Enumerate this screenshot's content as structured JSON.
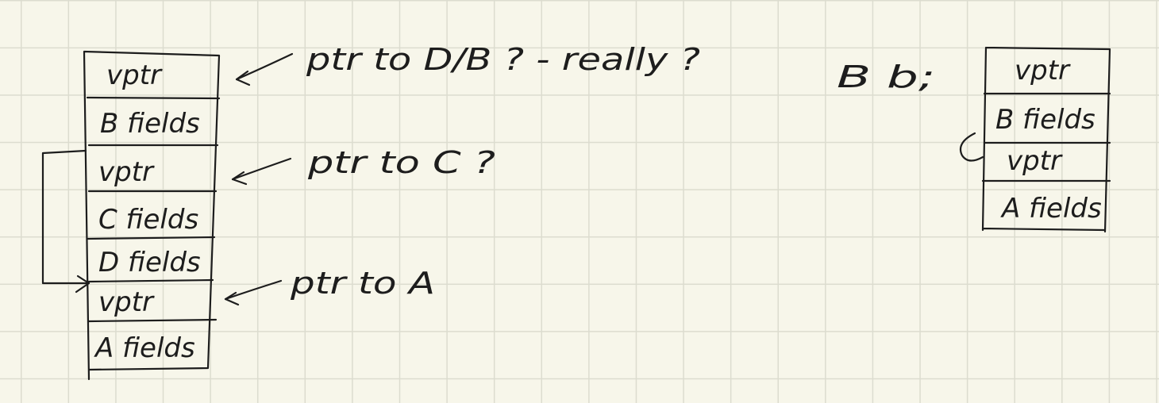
{
  "left_stack": {
    "cells": [
      "vptr",
      "B fields",
      "vptr",
      "C fields",
      "D fields",
      "vptr",
      "A fields"
    ]
  },
  "annotations": {
    "ptr_d_b": "ptr to D/B ? - really ?",
    "ptr_c": "ptr to C ?",
    "ptr_a": "ptr to A"
  },
  "right_object": {
    "declaration": "B b;",
    "cells": [
      "vptr",
      "B fields",
      "vptr",
      "A fields"
    ]
  }
}
